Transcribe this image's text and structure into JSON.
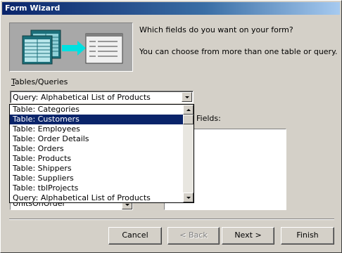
{
  "window": {
    "title": "Form Wizard"
  },
  "header": {
    "prompt": "Which fields do you want on your form?",
    "hint": "You can choose from more than one table or query."
  },
  "tables": {
    "label_underline": "T",
    "label_rest": "ables/Queries",
    "selected": "Query: Alphabetical List of Products",
    "options": [
      "Table: Categories",
      "Table: Customers",
      "Table: Employees",
      "Table: Order Details",
      "Table: Orders",
      "Table: Products",
      "Table: Shippers",
      "Table: Suppliers",
      "Table: tblProjects",
      "Query: Alphabetical List of Products"
    ],
    "highlighted_index": 1
  },
  "available_fields": {
    "peek_item": "UnitsOnOrder"
  },
  "selected_fields": {
    "label": "Fields:"
  },
  "buttons": {
    "cancel": "Cancel",
    "back": "< Back",
    "next": "Next >",
    "finish": "Finish"
  }
}
